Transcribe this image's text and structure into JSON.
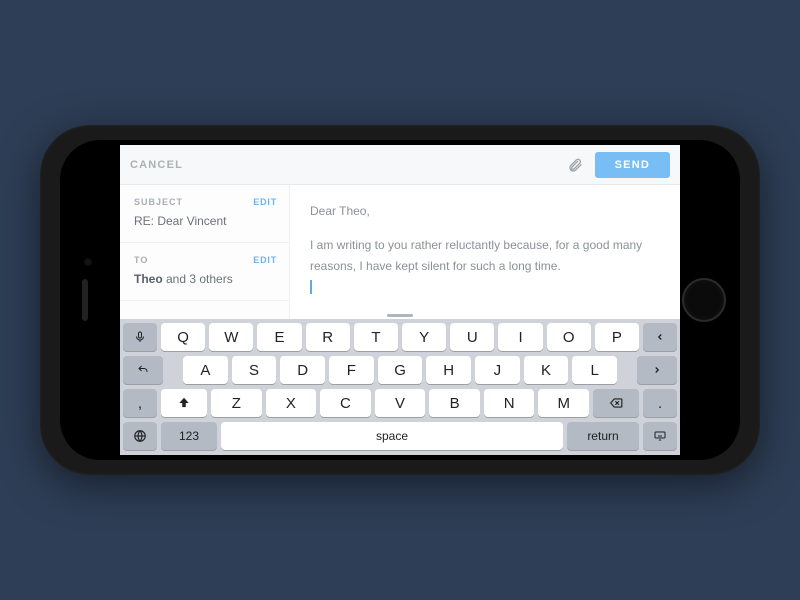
{
  "toolbar": {
    "cancel": "CANCEL",
    "send": "SEND"
  },
  "meta": {
    "subject_label": "SUBJECT",
    "subject_edit": "EDIT",
    "subject_value": "RE: Dear Vincent",
    "to_label": "TO",
    "to_edit": "EDIT",
    "to_strong": "Theo",
    "to_rest": " and 3 others"
  },
  "compose": {
    "greeting": "Dear Theo,",
    "body": "I am writing to you rather reluctantly because, for a good many reasons, I have kept silent for such a long time."
  },
  "keyboard": {
    "row1": [
      "Q",
      "W",
      "E",
      "R",
      "T",
      "Y",
      "U",
      "I",
      "O",
      "P"
    ],
    "row2": [
      "A",
      "S",
      "D",
      "F",
      "G",
      "H",
      "J",
      "K",
      "L"
    ],
    "row3": [
      "Z",
      "X",
      "C",
      "V",
      "B",
      "N",
      "M"
    ],
    "num": "123",
    "space": "space",
    "return": "return",
    "comma": ",",
    "period": "."
  }
}
